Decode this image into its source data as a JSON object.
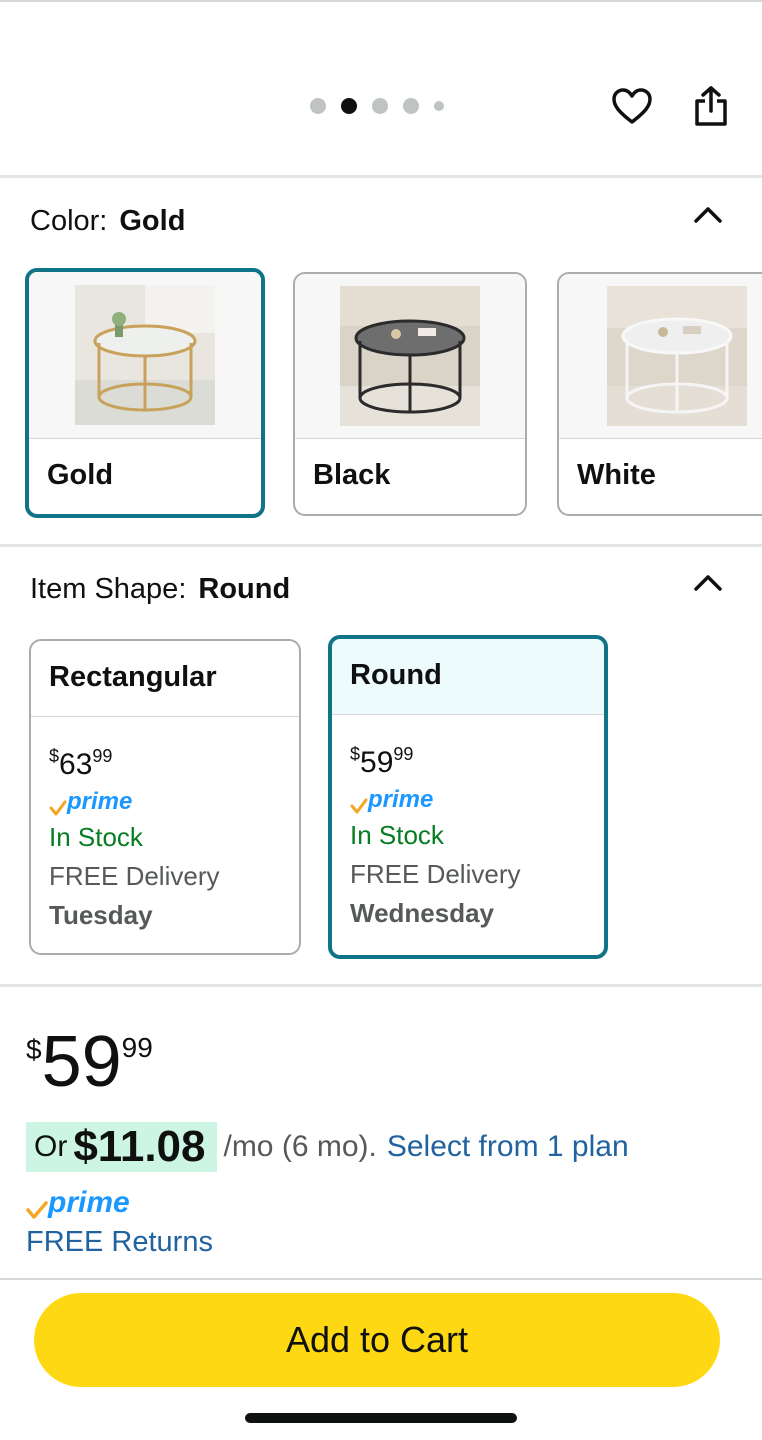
{
  "gallery": {
    "dot_count": 5,
    "active_dot": 1
  },
  "icons": {
    "favorite": "heart-icon",
    "share": "share-icon",
    "collapse": "chevron-up-icon"
  },
  "color_section": {
    "label": "Color:",
    "selected": "Gold",
    "options": [
      {
        "name": "Gold",
        "frame_color": "#c8a25a"
      },
      {
        "name": "Black",
        "frame_color": "#2b2b2b"
      },
      {
        "name": "White",
        "frame_color": "#f2f2f2"
      }
    ]
  },
  "shape_section": {
    "label": "Item Shape:",
    "selected": "Round",
    "options": [
      {
        "name": "Rectangular",
        "price_symbol": "$",
        "price_whole": "63",
        "price_fraction": "99",
        "prime": "prime",
        "stock": "In Stock",
        "delivery": "FREE Delivery",
        "day": "Tuesday"
      },
      {
        "name": "Round",
        "price_symbol": "$",
        "price_whole": "59",
        "price_fraction": "99",
        "prime": "prime",
        "stock": "In Stock",
        "delivery": "FREE Delivery",
        "day": "Wednesday"
      }
    ]
  },
  "price": {
    "symbol": "$",
    "whole": "59",
    "fraction": "99",
    "monthly_prefix": "Or",
    "monthly_amount": "$11.08",
    "monthly_suffix": "/mo (6 mo).",
    "plan_link": "Select from 1 plan"
  },
  "prime_badge": "prime",
  "returns": "FREE Returns",
  "add_to_cart": "Add to Cart",
  "colors": {
    "accent_selected": "#0f7488",
    "cart_button": "#ffd814",
    "link": "#2162a1",
    "in_stock": "#067d22",
    "prime": "#1a98ff",
    "prime_check": "#f5a623",
    "monthly_highlight": "#cdf5e3"
  }
}
